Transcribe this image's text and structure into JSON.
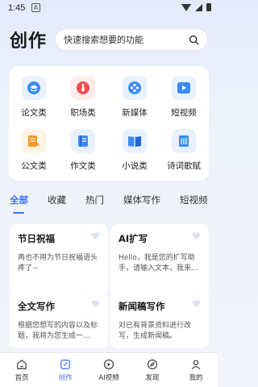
{
  "status": {
    "time": "1:45",
    "badge": "A"
  },
  "header": {
    "title": "创作",
    "search_placeholder": "快速搜索想要的功能"
  },
  "categories": [
    {
      "label": "论文类",
      "icon": "graduation-cap-icon",
      "color": "#3d8af7",
      "bg": "#e8f1ff"
    },
    {
      "label": "职场类",
      "icon": "necktie-icon",
      "color": "#ef4f4f",
      "bg": "#ffeceb"
    },
    {
      "label": "新媒体",
      "icon": "film-reel-icon",
      "color": "#3d8af7",
      "bg": "#e8f1ff"
    },
    {
      "label": "短视频",
      "icon": "play-icon",
      "color": "#3d8af7",
      "bg": "#e8f1ff"
    },
    {
      "label": "公文类",
      "icon": "document-edit-icon",
      "color": "#f59a2a",
      "bg": "#fff3e3"
    },
    {
      "label": "作文类",
      "icon": "notebook-icon",
      "color": "#3d8af7",
      "bg": "#e8f1ff"
    },
    {
      "label": "小说类",
      "icon": "open-book-icon",
      "color": "#3d8af7",
      "bg": "#e8f1ff"
    },
    {
      "label": "诗词歌赋",
      "icon": "poetry-book-icon",
      "color": "#3d8af7",
      "bg": "#e8f1ff"
    }
  ],
  "tabs": [
    "全部",
    "收藏",
    "热门",
    "媒体写作",
    "短视频"
  ],
  "cards": [
    {
      "title": "节日祝福",
      "desc": "再也不用为节日祝福语头疼了~"
    },
    {
      "title": "AI扩写",
      "desc": "Hello，我是您的扩写助手，请输入文本，我来..."
    },
    {
      "title": "全文写作",
      "desc": "根据您想写的内容以及标题，我将为您生成一..."
    },
    {
      "title": "新闻稿写作",
      "desc": "对已有背景资料进行改写，生成新闻稿。"
    }
  ],
  "tabbar": [
    {
      "label": "首页",
      "icon": "home-icon"
    },
    {
      "label": "创作",
      "icon": "create-icon"
    },
    {
      "label": "AI视频",
      "icon": "video-play-icon"
    },
    {
      "label": "发现",
      "icon": "compass-icon"
    },
    {
      "label": "我的",
      "icon": "profile-icon"
    }
  ],
  "accent": "#3b6fff"
}
